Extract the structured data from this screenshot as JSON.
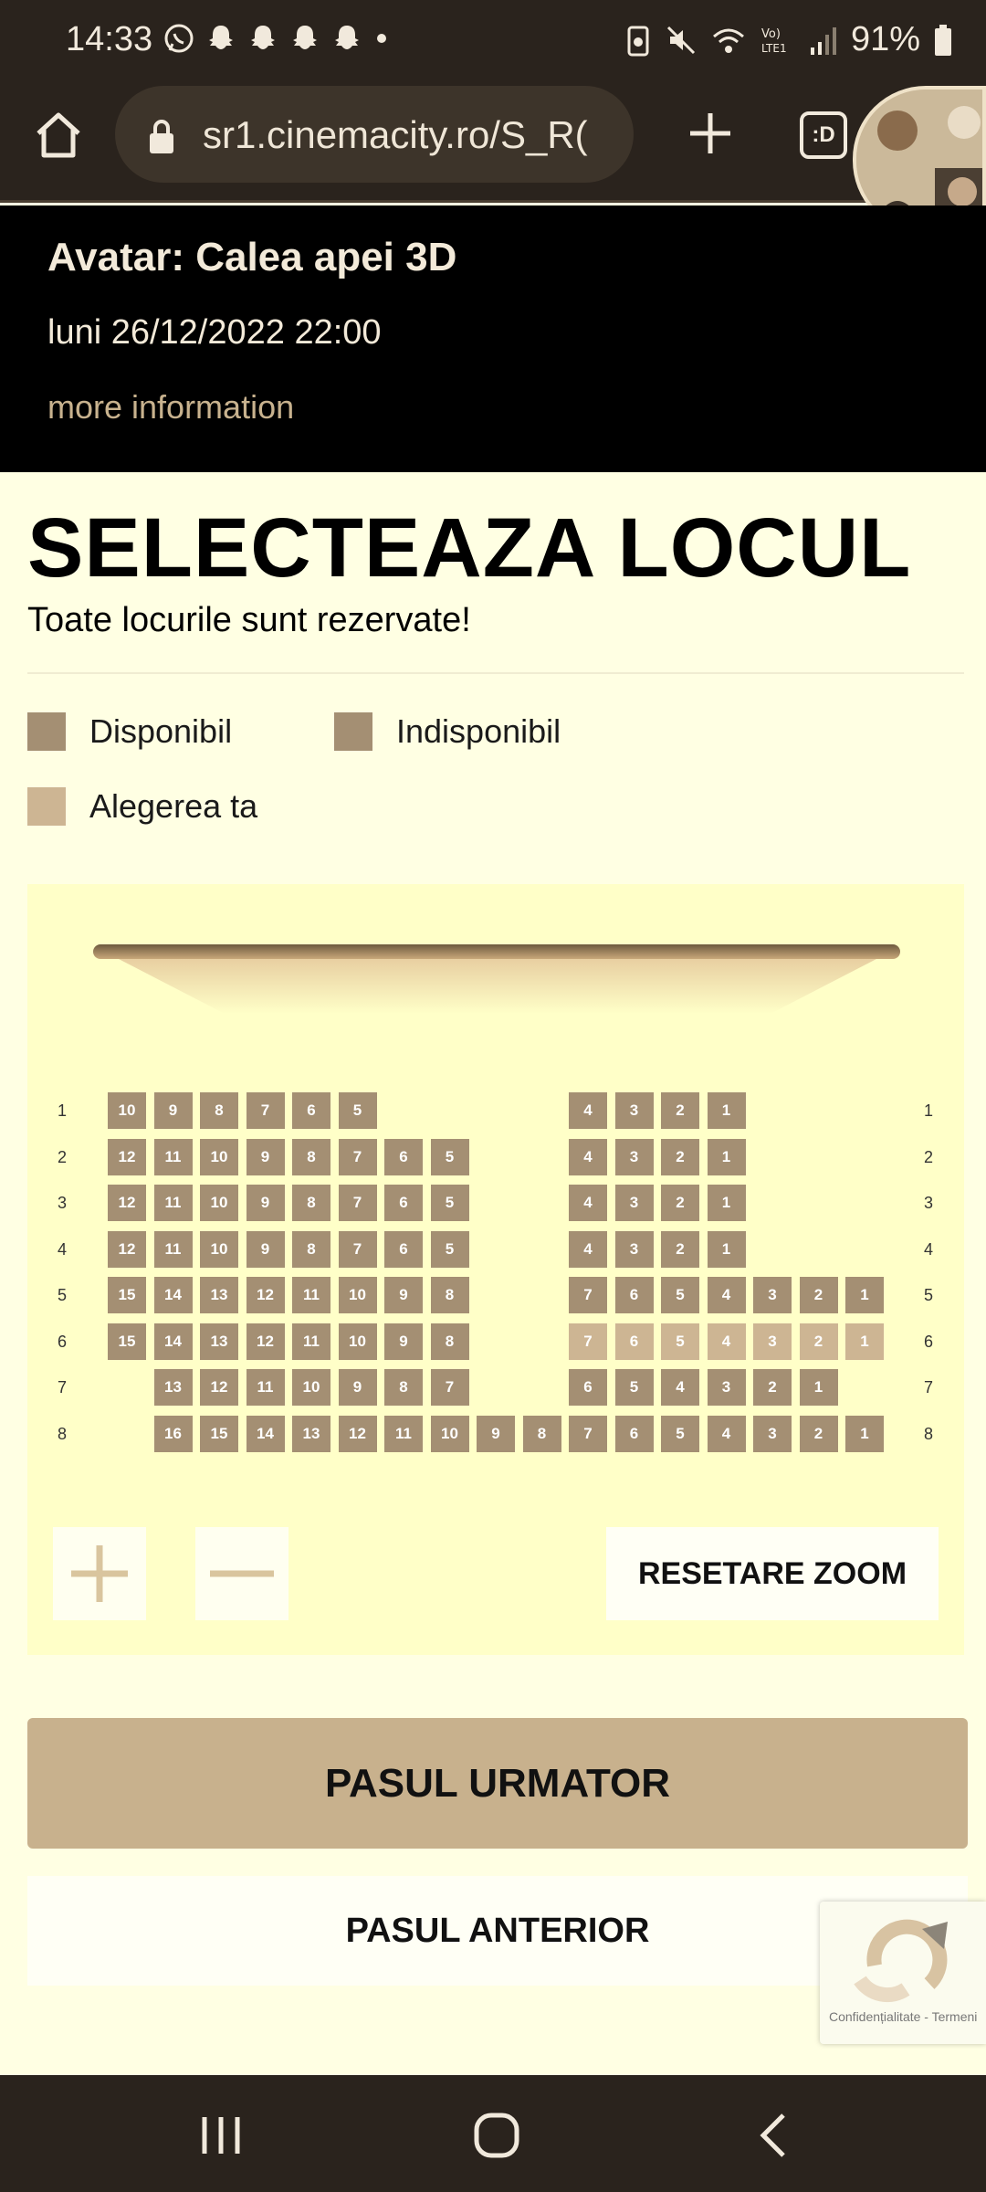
{
  "status_bar": {
    "time": "14:33",
    "battery": "91%"
  },
  "browser": {
    "url": "sr1.cinemacity.ro/S_R(",
    "tabs_label": ":D"
  },
  "movie": {
    "title": "Avatar: Calea apei 3D",
    "datetime": "luni 26/12/2022 22:00",
    "more_info": "more information"
  },
  "page": {
    "heading": "SELECTEAZA LOCUL",
    "subtitle": "Toate locurile sunt rezervate!"
  },
  "legend": {
    "available": "Disponibil",
    "unavailable": "Indisponibil",
    "your_choice": "Alegerea ta",
    "colors": {
      "available": "#a48f73",
      "unavailable": "#a48f73",
      "your_choice": "#cdb593"
    }
  },
  "seat_map": {
    "rows": [
      {
        "label": "1",
        "seats": [
          "10",
          "9",
          "8",
          "7",
          "6",
          "5",
          null,
          null,
          null,
          null,
          "4",
          "3",
          "2",
          "1",
          null,
          null,
          null
        ]
      },
      {
        "label": "2",
        "seats": [
          "12",
          "11",
          "10",
          "9",
          "8",
          "7",
          "6",
          "5",
          null,
          null,
          "4",
          "3",
          "2",
          "1",
          null,
          null,
          null
        ]
      },
      {
        "label": "3",
        "seats": [
          "12",
          "11",
          "10",
          "9",
          "8",
          "7",
          "6",
          "5",
          null,
          null,
          "4",
          "3",
          "2",
          "1",
          null,
          null,
          null
        ]
      },
      {
        "label": "4",
        "seats": [
          "12",
          "11",
          "10",
          "9",
          "8",
          "7",
          "6",
          "5",
          null,
          null,
          "4",
          "3",
          "2",
          "1",
          null,
          null,
          null
        ]
      },
      {
        "label": "5",
        "seats": [
          "15",
          "14",
          "13",
          "12",
          "11",
          "10",
          "9",
          "8",
          null,
          null,
          "7",
          "6",
          "5",
          "4",
          "3",
          "2",
          "1"
        ]
      },
      {
        "label": "6",
        "seats": [
          "15",
          "14",
          "13",
          "12",
          "11",
          "10",
          "9",
          "8",
          null,
          null,
          "7",
          "6",
          "5",
          "4",
          "3",
          "2",
          "1"
        ],
        "light_from": 10
      },
      {
        "label": "7",
        "seats": [
          null,
          "13",
          "12",
          "11",
          "10",
          "9",
          "8",
          "7",
          null,
          null,
          "6",
          "5",
          "4",
          "3",
          "2",
          "1",
          null
        ]
      },
      {
        "label": "8",
        "seats": [
          null,
          "16",
          "15",
          "14",
          "13",
          "12",
          "11",
          "10",
          "9",
          "8",
          "7",
          "6",
          "5",
          "4",
          "3",
          "2",
          "1"
        ]
      }
    ]
  },
  "zoom": {
    "reset_label": "RESETARE ZOOM"
  },
  "actions": {
    "next_label": "PASUL URMATOR",
    "prev_label": "PASUL ANTERIOR"
  },
  "recaptcha": {
    "links": "Confidențialitate - Termeni"
  }
}
